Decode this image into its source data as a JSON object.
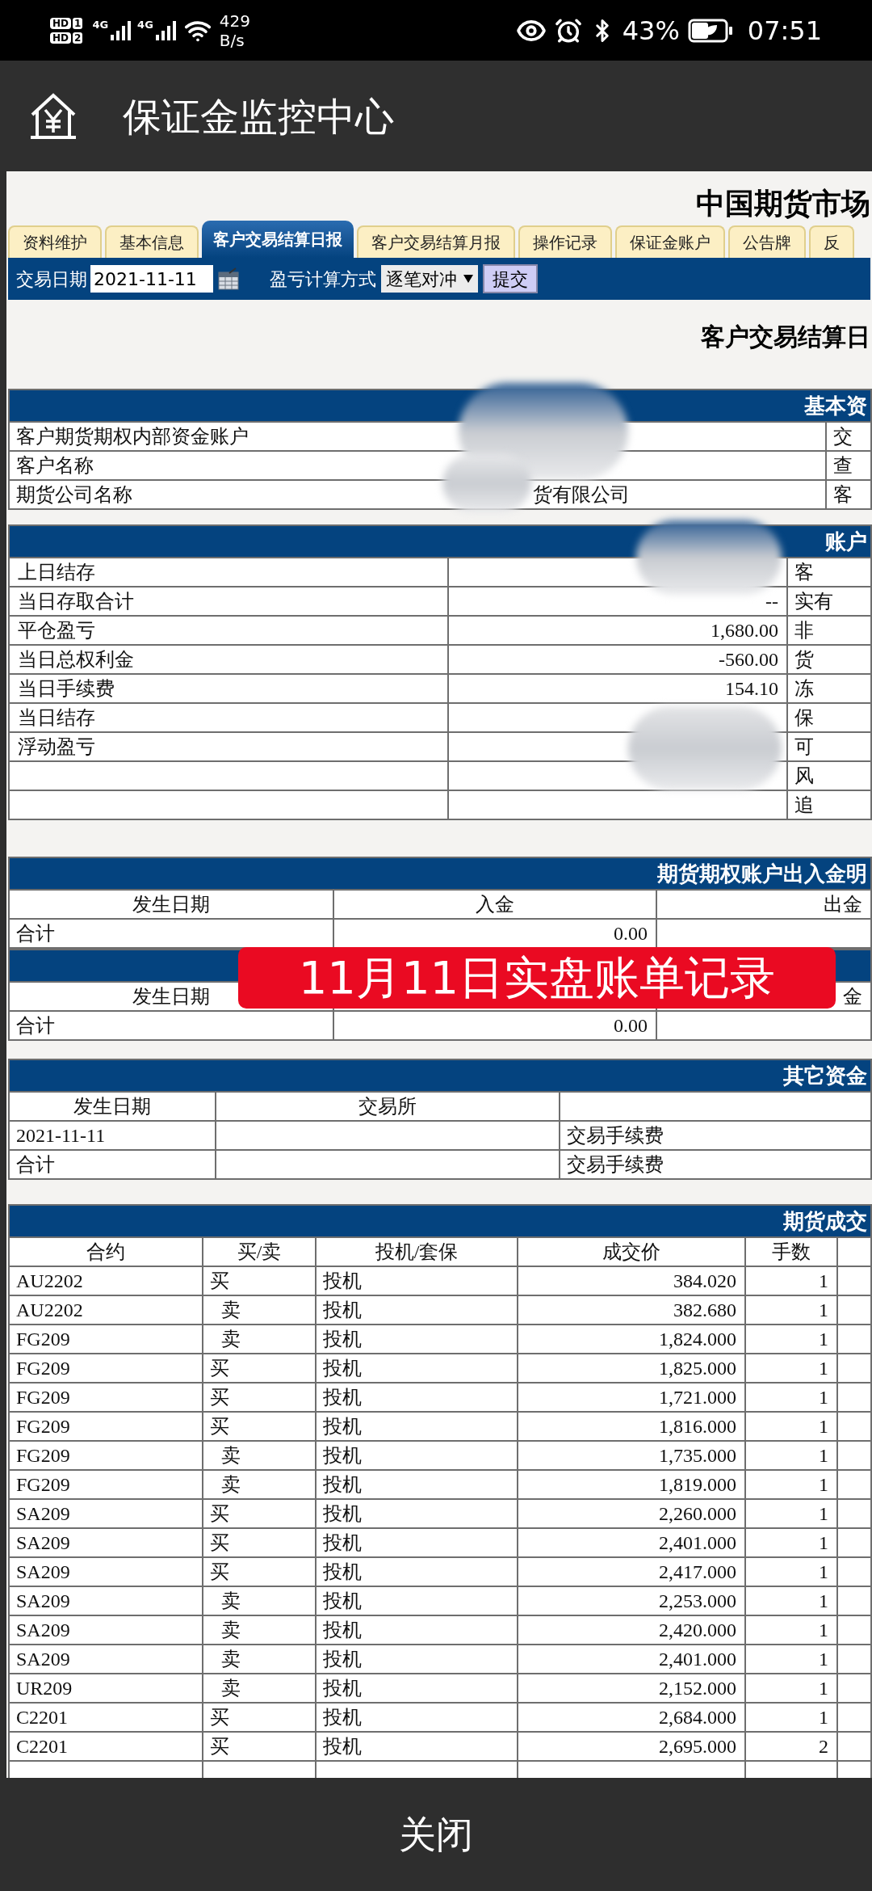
{
  "status_bar": {
    "sims": [
      {
        "label": "HD",
        "slot": "1"
      },
      {
        "label": "HD",
        "slot": "2"
      }
    ],
    "signals": [
      {
        "network": "4G"
      },
      {
        "network": "4G"
      }
    ],
    "speed": "429",
    "speed_unit": "B/s",
    "battery": "43%",
    "time": "07:51"
  },
  "app_bar": {
    "title": "保证金监控中心"
  },
  "page": {
    "site_title": "中国期货市场",
    "tabs": [
      {
        "label": "资料维护",
        "selected": false
      },
      {
        "label": "基本信息",
        "selected": false
      },
      {
        "label": "客户交易结算日报",
        "selected": true
      },
      {
        "label": "客户交易结算月报",
        "selected": false
      },
      {
        "label": "操作记录",
        "selected": false
      },
      {
        "label": "保证金账户",
        "selected": false
      },
      {
        "label": "公告牌",
        "selected": false
      },
      {
        "label": "反",
        "selected": false
      }
    ],
    "toolbar": {
      "date_label": "交易日期",
      "date_value": "2021-11-11",
      "method_label": "盈亏计算方式",
      "method_value": "逐笔对冲",
      "submit": "提交"
    },
    "report_title": "客户交易结算日",
    "sections": [
      {
        "kind": "account_info",
        "title": "基本资",
        "rows": [
          {
            "label": "客户期货期权内部资金账户",
            "side": "交"
          },
          {
            "label": "客户名称",
            "side": "查"
          },
          {
            "label": "期货公司名称",
            "value": "货有限公司",
            "side": "客"
          }
        ]
      },
      {
        "kind": "balance",
        "title": "账户",
        "rows": [
          {
            "label": "上日结存",
            "side": "客"
          },
          {
            "label": "当日存取合计",
            "value": "--",
            "side": "实有"
          },
          {
            "label": "平仓盈亏",
            "value": "1,680.00",
            "side": "非"
          },
          {
            "label": "当日总权利金",
            "value": "-560.00",
            "side": "货"
          },
          {
            "label": "当日手续费",
            "value": "154.10",
            "side": "冻"
          },
          {
            "label": "当日结存",
            "side": "保"
          },
          {
            "label": "浮动盈亏",
            "side": "可"
          },
          {
            "side": "风"
          },
          {
            "side": "追"
          }
        ]
      },
      {
        "kind": "cash_flow",
        "title": "期货期权账户出入金明",
        "columns": {
          "date": "发生日期",
          "in": "入金",
          "out": "出金"
        },
        "rows": [
          {
            "label": "合计",
            "in": "0.00"
          }
        ]
      },
      {
        "kind": "cash_flow",
        "columns": {
          "date": "发生日期",
          "out": "金"
        },
        "rows": [
          {
            "label": "合计",
            "in": "0.00"
          }
        ]
      },
      {
        "kind": "other_funds",
        "title": "其它资金",
        "columns": {
          "date": "发生日期",
          "exchange": "交易所"
        },
        "rows": [
          {
            "date": "2021-11-11",
            "item": "交易手续费"
          },
          {
            "date": "合计",
            "item": "交易手续费"
          }
        ]
      },
      {
        "kind": "trades",
        "title": "期货成交",
        "columns": [
          "合约",
          "买/卖",
          "投机/套保",
          "成交价",
          "手数"
        ],
        "rows": [
          {
            "contract": "AU2202",
            "kind": "buy",
            "side": "买",
            "hedge": "投机",
            "price": "384.020",
            "lots": "1"
          },
          {
            "contract": "AU2202",
            "kind": "sell",
            "side": "卖",
            "hedge": "投机",
            "price": "382.680",
            "lots": "1"
          },
          {
            "contract": "FG209",
            "kind": "sell",
            "side": "卖",
            "hedge": "投机",
            "price": "1,824.000",
            "lots": "1"
          },
          {
            "contract": "FG209",
            "kind": "buy",
            "side": "买",
            "hedge": "投机",
            "price": "1,825.000",
            "lots": "1"
          },
          {
            "contract": "FG209",
            "kind": "buy",
            "side": "买",
            "hedge": "投机",
            "price": "1,721.000",
            "lots": "1"
          },
          {
            "contract": "FG209",
            "kind": "buy",
            "side": "买",
            "hedge": "投机",
            "price": "1,816.000",
            "lots": "1"
          },
          {
            "contract": "FG209",
            "kind": "sell",
            "side": "卖",
            "hedge": "投机",
            "price": "1,735.000",
            "lots": "1"
          },
          {
            "contract": "FG209",
            "kind": "sell",
            "side": "卖",
            "hedge": "投机",
            "price": "1,819.000",
            "lots": "1"
          },
          {
            "contract": "SA209",
            "kind": "buy",
            "side": "买",
            "hedge": "投机",
            "price": "2,260.000",
            "lots": "1"
          },
          {
            "contract": "SA209",
            "kind": "buy",
            "side": "买",
            "hedge": "投机",
            "price": "2,401.000",
            "lots": "1"
          },
          {
            "contract": "SA209",
            "kind": "buy",
            "side": "买",
            "hedge": "投机",
            "price": "2,417.000",
            "lots": "1"
          },
          {
            "contract": "SA209",
            "kind": "sell",
            "side": "卖",
            "hedge": "投机",
            "price": "2,253.000",
            "lots": "1"
          },
          {
            "contract": "SA209",
            "kind": "sell",
            "side": "卖",
            "hedge": "投机",
            "price": "2,420.000",
            "lots": "1"
          },
          {
            "contract": "SA209",
            "kind": "sell",
            "side": "卖",
            "hedge": "投机",
            "price": "2,401.000",
            "lots": "1"
          },
          {
            "contract": "UR209",
            "kind": "sell",
            "side": "卖",
            "hedge": "投机",
            "price": "2,152.000",
            "lots": "1"
          },
          {
            "contract": "C2201",
            "kind": "buy",
            "side": "买",
            "hedge": "投机",
            "price": "2,684.000",
            "lots": "1"
          },
          {
            "contract": "C2201",
            "kind": "buy",
            "side": "买",
            "hedge": "投机",
            "price": "2,695.000",
            "lots": "2"
          }
        ]
      }
    ]
  },
  "overlay_caption": "11月11日实盘账单记录",
  "close_button": "关闭"
}
